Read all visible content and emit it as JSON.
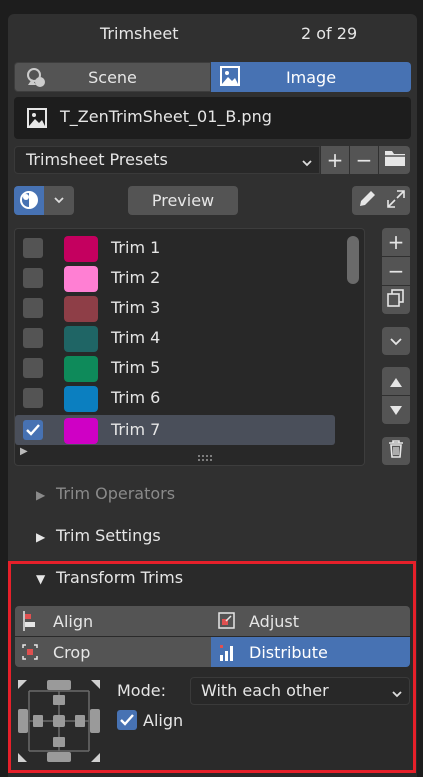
{
  "header": {
    "title": "Trimsheet",
    "count": "2 of 29"
  },
  "source_toggle": {
    "scene_label": "Scene",
    "image_label": "Image",
    "selected": "Image"
  },
  "image_file": {
    "name": "T_ZenTrimSheet_01_B.png"
  },
  "presets": {
    "label": "Trimsheet Presets",
    "add": "+",
    "remove": "−"
  },
  "toolbar": {
    "preview_label": "Preview"
  },
  "trims": [
    {
      "name": "Trim 1",
      "color": "#c4005f",
      "checked": false
    },
    {
      "name": "Trim 2",
      "color": "#ff7fd3",
      "checked": false
    },
    {
      "name": "Trim 3",
      "color": "#8e3e47",
      "checked": false
    },
    {
      "name": "Trim 4",
      "color": "#1f6565",
      "checked": false
    },
    {
      "name": "Trim 5",
      "color": "#0e8a5a",
      "checked": false
    },
    {
      "name": "Trim 6",
      "color": "#0b7fc0",
      "checked": false
    },
    {
      "name": "Trim 7",
      "color": "#cf00c5",
      "checked": true
    }
  ],
  "list_side": {
    "add": "+",
    "remove": "−"
  },
  "sections": {
    "trim_operators": "Trim Operators",
    "trim_settings": "Trim Settings",
    "transform_trims": "Transform Trims"
  },
  "transform": {
    "align": "Align",
    "adjust": "Adjust",
    "crop": "Crop",
    "distribute": "Distribute",
    "selected": "Distribute",
    "mode_label": "Mode:",
    "mode_value": "With each other",
    "align_checkbox": "Align",
    "align_checked": true
  },
  "colors": {
    "accent": "#4772b3",
    "panel": "#303030",
    "highlight_box": "#e6202a"
  }
}
